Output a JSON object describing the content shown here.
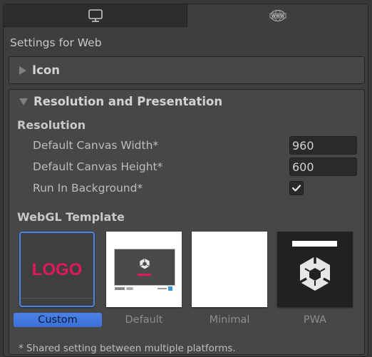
{
  "tabs": [
    {
      "name": "Standalone",
      "icon": "monitor-icon",
      "active": false
    },
    {
      "name": "Web",
      "icon": "www-globe-icon",
      "active": true
    }
  ],
  "settings_title": "Settings for Web",
  "icon_foldout": {
    "label": "Icon",
    "expanded": false
  },
  "resolution_foldout": {
    "label": "Resolution and Presentation",
    "expanded": true,
    "resolution_section": "Resolution",
    "fields": {
      "canvas_width": {
        "label": "Default Canvas Width*",
        "value": "960"
      },
      "canvas_height": {
        "label": "Default Canvas Height*",
        "value": "600"
      },
      "run_in_background": {
        "label": "Run In Background*",
        "checked": true
      }
    },
    "webgl_template_section": "WebGL Template",
    "templates": [
      {
        "name": "Custom",
        "selected": true,
        "thumb_text": "LOGO"
      },
      {
        "name": "Default",
        "selected": false
      },
      {
        "name": "Minimal",
        "selected": false
      },
      {
        "name": "PWA",
        "selected": false
      }
    ],
    "footnote": "* Shared setting between multiple platforms."
  },
  "colors": {
    "selection_accent": "#4a82e8",
    "logo_pink": "#e2185a"
  }
}
